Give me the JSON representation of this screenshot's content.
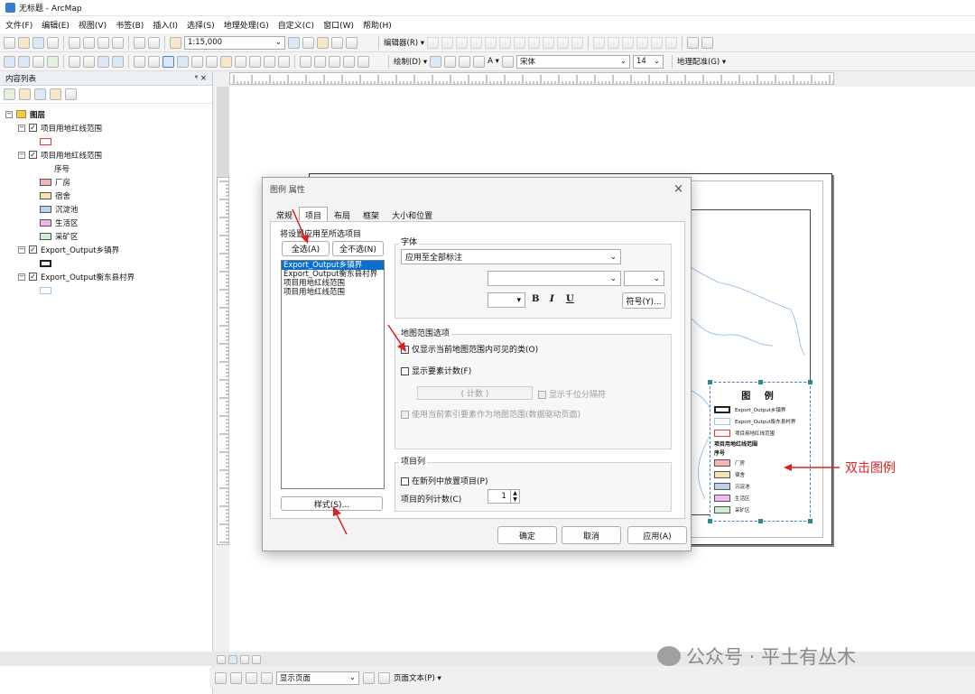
{
  "window": {
    "title": "无标题 - ArcMap"
  },
  "menus": [
    "文件(F)",
    "编辑(E)",
    "视图(V)",
    "书签(B)",
    "插入(I)",
    "选择(S)",
    "地理处理(G)",
    "自定义(C)",
    "窗口(W)",
    "帮助(H)"
  ],
  "toolbar": {
    "scale": "1:15,000",
    "editor_label": "编辑器(R) ▾",
    "draw_label": "绘制(D) ▾",
    "font_name": "宋体",
    "font_size": "14",
    "georef_label": "地理配准(G) ▾"
  },
  "toc": {
    "title": "内容列表",
    "pin": "ᵠ ×",
    "root": "图层",
    "layers": [
      {
        "name": "项目用地红线范围"
      },
      {
        "name": "项目用地红线范围",
        "field": "序号",
        "classes": [
          {
            "label": "厂房",
            "color": "#f4b6b2"
          },
          {
            "label": "宿舍",
            "color": "#f7e3b1"
          },
          {
            "label": "沉淀池",
            "color": "#b9d0ee"
          },
          {
            "label": "生活区",
            "color": "#eeb6ec"
          },
          {
            "label": "采矿区",
            "color": "#cdeecf"
          }
        ]
      },
      {
        "name": "Export_Output乡镇界"
      },
      {
        "name": "Export_Output衡东县村界"
      }
    ]
  },
  "dialog": {
    "title": "图例 属性",
    "close": "×",
    "tabs": [
      "常规",
      "项目",
      "布局",
      "框架",
      "大小和位置"
    ],
    "apply_to_label": "将设置应用至所选项目",
    "select_all": "全选(A)",
    "select_none": "全不选(N)",
    "items": [
      "Export_Output乡镇界",
      "Export_Output衡东县村界",
      "项目用地红线范围",
      "项目用地红线范围"
    ],
    "style_button": "样式(S)...",
    "font_group": "字体",
    "font_apply": "应用至全部标注",
    "bold": "B",
    "italic": "I",
    "underline": "U",
    "symbol_button": "符号(Y)...",
    "extent_group": "地图范围选项",
    "only_visible": "仅显示当前地图范围内可见的类(O)",
    "show_count": "显示要素计数(F)",
    "count_placeholder": "(   计数   )",
    "thousands": "显示千位分隔符",
    "use_index": "使用当前索引要素作为地图范围(数据驱动页面)",
    "columns_group": "项目列",
    "new_column": "在新列中放置项目(P)",
    "column_count_label": "项目的列计数(C)",
    "column_count": "1",
    "ok": "确定",
    "cancel": "取消",
    "apply": "应用(A)"
  },
  "legend": {
    "title": "图 例",
    "rows": [
      "Export_Output乡镇界",
      "Export_Output衡东县村界",
      "项目用地红线范围"
    ],
    "heading": "项目用地红线范围",
    "field": "序号",
    "classes": [
      "厂房",
      "宿舍",
      "沉淀池",
      "生活区",
      "采矿区"
    ]
  },
  "annotation": "双击图例",
  "bottom": {
    "page_select": "显示页面",
    "page_text": "页面文本(P) ▾"
  },
  "watermark": "公众号 · 平土有丛木"
}
